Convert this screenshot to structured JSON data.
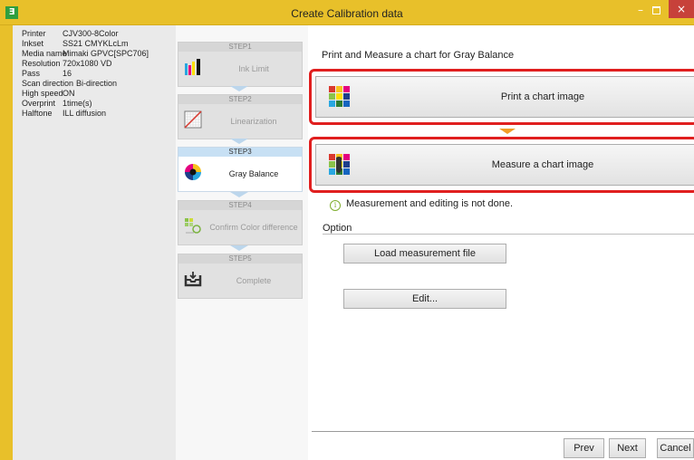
{
  "window": {
    "title": "Create Calibration data",
    "app_icon_glyph": "Ǝ",
    "minimize_glyph": "–",
    "close_glyph": "×",
    "accent_color": "#e8c02a"
  },
  "printer_info": [
    {
      "key": "Printer",
      "value": "CJV300-8Color"
    },
    {
      "key": "Inkset",
      "value": "SS21 CMYKLcLm"
    },
    {
      "key": "Media name",
      "value": "Mimaki GPVC[SPC706]"
    },
    {
      "key": "Resolution",
      "value": "720x1080 VD"
    },
    {
      "key": "Pass",
      "value": "16"
    },
    {
      "key": "Scan direction",
      "value": "Bi-direction"
    },
    {
      "key": "High speed",
      "value": "ON"
    },
    {
      "key": "Overprint",
      "value": "1time(s)"
    },
    {
      "key": "Halftone",
      "value": "ILL diffusion"
    }
  ],
  "steps": [
    {
      "label": "STEP1",
      "name": "Ink Limit",
      "icon": "ink-bars-icon",
      "active": false
    },
    {
      "label": "STEP2",
      "name": "Linearization",
      "icon": "linearization-curve-icon",
      "active": false
    },
    {
      "label": "STEP3",
      "name": "Gray Balance",
      "icon": "color-wheel-icon",
      "active": true
    },
    {
      "label": "STEP4",
      "name": "Confirm Color difference",
      "icon": "color-difference-icon",
      "active": false
    },
    {
      "label": "STEP5",
      "name": "Complete",
      "icon": "tray-complete-icon",
      "active": false
    }
  ],
  "main": {
    "heading": "Print and Measure a chart for Gray Balance",
    "print_button": "Print a chart image",
    "measure_button": "Measure a chart image",
    "status": "Measurement and editing is not done.",
    "option_label": "Option",
    "load_button": "Load measurement file",
    "edit_button": "Edit..."
  },
  "footer": {
    "prev": "Prev",
    "next": "Next",
    "cancel": "Cancel"
  },
  "colors": {
    "highlight_frame": "#e01f1f",
    "flow_arrow": "#f29d26",
    "active_step": "#c7e0f4"
  }
}
